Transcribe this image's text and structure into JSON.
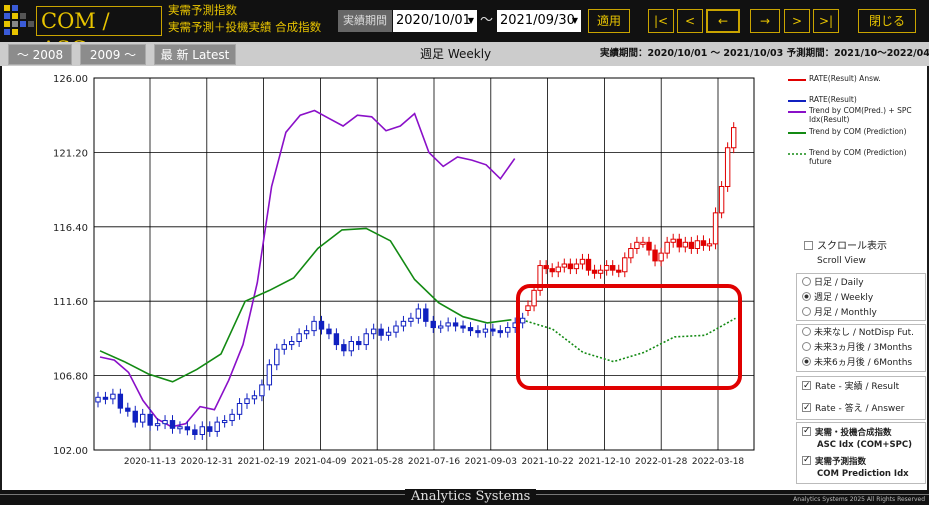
{
  "header": {
    "brand": "COM / ASC",
    "subtitle1": "実需予測指数",
    "subtitle2": "実需予測＋投機実績 合成指数",
    "period_label": "実績期間",
    "date_from": "2020/10/01",
    "date_to": "2021/09/30",
    "tilde": "～",
    "apply": "適用",
    "nav": [
      "|<",
      "<",
      "←",
      "→",
      ">",
      ">|"
    ],
    "close": "閉じる"
  },
  "tabs": [
    "～ 2008",
    "2009 ～",
    "最 新  Latest"
  ],
  "period_title": "週足 Weekly",
  "period_info": "実績期間：2020/10/01 ～ 2021/10/03  予測期間：2021/10～2022/04",
  "legend": [
    {
      "label": "RATE(Result) Answ.",
      "color": "#e00000",
      "style": "solid"
    },
    {
      "label": "RATE(Result)",
      "color": "#1020c0",
      "style": "solid"
    },
    {
      "label": "Trend by COM(Pred.) + SPC Idx(Result)",
      "color": "#8a10c8",
      "style": "solid"
    },
    {
      "label": "Trend by COM (Prediction)",
      "color": "#138a13",
      "style": "solid"
    },
    {
      "label": "Trend by COM (Prediction) future",
      "color": "#138a13",
      "style": "dotted"
    }
  ],
  "controls": {
    "scroll_view": "スクロール表示\nScroll View",
    "scroll_line1": "スクロール表示",
    "scroll_line2": "Scroll View",
    "freq": [
      "日足 / Daily",
      "週足 / Weekly",
      "月足 / Monthly"
    ],
    "freq_selected": 1,
    "future": [
      "未来なし / NotDisp Fut.",
      "未来3ヵ月後 / 3Months",
      "未来6ヵ月後 / 6Months"
    ],
    "future_selected": 2,
    "rate_result": "Rate - 実績 / Result",
    "rate_answer": "Rate - 答え / Answer",
    "asc_line1": "実需・投機合成指数",
    "asc_line2": "ASC Idx (COM+SPC)",
    "com_line1": "実需予測指数",
    "com_line2": "COM Prediction Idx"
  },
  "footer": {
    "brand": "Analytics Systems",
    "copyright": "Analytics Systems 2025 All Rights Reserved"
  },
  "chart_data": {
    "type": "line",
    "y_ticks": [
      "126.00",
      "121.20",
      "116.40",
      "111.60",
      "106.80",
      "102.00"
    ],
    "ylim": [
      102,
      126
    ],
    "x_ticks": [
      "2020-11-13",
      "2020-12-31",
      "2021-02-19",
      "2021-04-09",
      "2021-05-28",
      "2021-07-16",
      "2021-09-03",
      "2021-10-22",
      "2021-12-10",
      "2022-01-28",
      "2022-03-18"
    ],
    "grid": true,
    "series": [
      {
        "name": "RATE(Result)",
        "color": "#1020c0",
        "kind": "candlestick",
        "values": [
          105.4,
          105.3,
          105.6,
          104.7,
          104.5,
          103.8,
          104.3,
          103.6,
          103.7,
          103.9,
          103.4,
          103.5,
          103.3,
          103.0,
          103.5,
          103.2,
          103.8,
          103.9,
          104.3,
          105.0,
          105.3,
          105.5,
          106.2,
          107.5,
          108.5,
          108.8,
          109.0,
          109.5,
          109.7,
          110.3,
          109.8,
          109.5,
          108.8,
          108.4,
          109.0,
          108.8,
          109.5,
          109.8,
          109.4,
          109.6,
          110.0,
          110.3,
          110.5,
          111.1,
          110.3,
          109.9,
          110.0,
          110.2,
          110.0,
          109.9,
          109.7,
          109.6,
          109.8,
          109.7,
          109.6,
          109.9,
          110.2,
          110.5
        ]
      },
      {
        "name": "RATE(Result) Answ.",
        "color": "#e00000",
        "kind": "candlestick",
        "values": [
          111.3,
          112.3,
          113.9,
          113.7,
          113.5,
          113.8,
          114.0,
          113.7,
          114.0,
          114.3,
          113.6,
          113.4,
          113.6,
          113.9,
          113.6,
          113.5,
          114.4,
          115.0,
          115.4,
          115.4,
          114.9,
          114.2,
          114.7,
          115.4,
          115.6,
          115.1,
          115.4,
          115.0,
          115.5,
          115.2,
          115.3,
          117.3,
          119.0,
          121.5,
          122.8
        ]
      },
      {
        "name": "Trend by COM(Pred.) + SPC Idx(Result)",
        "color": "#8a10c8",
        "values": [
          108.0,
          107.8,
          107.0,
          105.2,
          104.0,
          103.5,
          103.7,
          104.8,
          104.6,
          106.5,
          108.8,
          112.8,
          119.0,
          122.5,
          123.6,
          123.9,
          123.4,
          122.9,
          123.6,
          123.5,
          122.6,
          122.9,
          123.7,
          121.2,
          120.3,
          120.9,
          120.7,
          120.4,
          119.5,
          120.8
        ]
      },
      {
        "name": "Trend by COM (Prediction)",
        "color": "#138a13",
        "values": [
          108.4,
          107.7,
          106.9,
          106.4,
          107.2,
          108.2,
          111.6,
          112.3,
          113.1,
          115.0,
          116.2,
          116.3,
          115.5,
          113.0,
          111.5,
          110.6,
          110.2,
          110.4
        ]
      },
      {
        "name": "Trend by COM (Prediction) future",
        "color": "#138a13",
        "style": "dotted",
        "values": [
          110.4,
          109.8,
          108.3,
          107.7,
          108.3,
          109.3,
          109.4,
          110.5
        ]
      }
    ]
  }
}
